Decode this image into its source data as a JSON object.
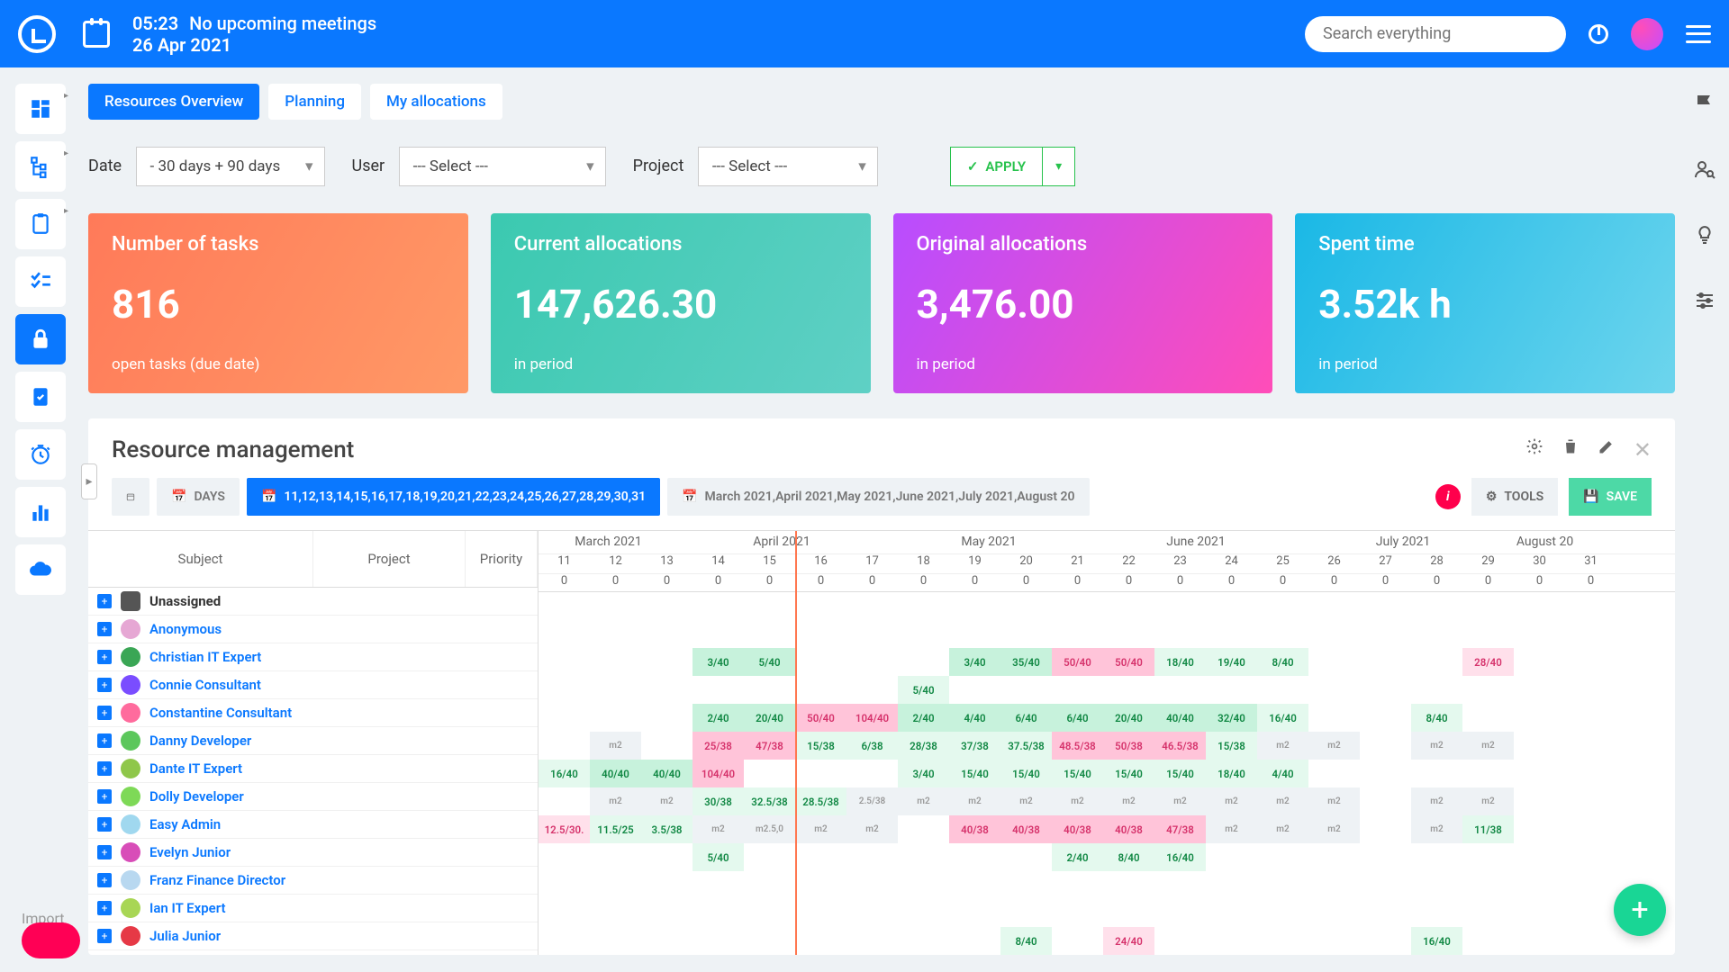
{
  "header": {
    "time": "05:23",
    "meet": "No upcoming meetings",
    "date": "26 Apr 2021",
    "search_ph": "Search everything"
  },
  "tabs": [
    "Resources Overview",
    "Planning",
    "My allocations"
  ],
  "filters": {
    "date_lbl": "Date",
    "date_val": "- 30 days + 90 days",
    "user_lbl": "User",
    "user_val": "--- Select ---",
    "proj_lbl": "Project",
    "proj_val": "--- Select ---",
    "apply": "APPLY"
  },
  "cards": [
    {
      "t": "Number of tasks",
      "v": "816",
      "s": "open tasks (due date)"
    },
    {
      "t": "Current allocations",
      "v": "147,626.30",
      "s": "in period"
    },
    {
      "t": "Original allocations",
      "v": "3,476.00",
      "s": "in period"
    },
    {
      "t": "Spent time",
      "v": "3.52k h",
      "s": "in period"
    }
  ],
  "rm": {
    "title": "Resource management",
    "days": "DAYS",
    "weeks": [
      "11",
      "12",
      "13",
      "14",
      "15",
      "16",
      "17",
      "18",
      "19",
      "20",
      "21",
      "22",
      "23",
      "24",
      "25",
      "26",
      "27",
      "28",
      "29",
      "30",
      "31"
    ],
    "months": [
      "March 2021",
      "April 2021",
      "May 2021",
      "June 2021",
      "July 2021",
      "August 20"
    ],
    "tools": "TOOLS",
    "save": "SAVE",
    "cols": {
      "subject": "Subject",
      "project": "Project",
      "priority": "Priority"
    },
    "zeros": [
      "0",
      "0",
      "0",
      "0",
      "0",
      "0",
      "0",
      "0",
      "0",
      "0",
      "0",
      "0",
      "0",
      "0",
      "0",
      "0",
      "0",
      "0",
      "0",
      "0",
      "0"
    ],
    "people": [
      {
        "name": "Unassigned",
        "clr": "#555"
      },
      {
        "name": "Anonymous",
        "clr": "#e6a7d4"
      },
      {
        "name": "Christian IT Expert",
        "clr": "#3aa655"
      },
      {
        "name": "Connie Consultant",
        "clr": "#7a4dff"
      },
      {
        "name": "Constantine Consultant",
        "clr": "#ff6b9d"
      },
      {
        "name": "Danny Developer",
        "clr": "#5cc75c"
      },
      {
        "name": "Dante IT Expert",
        "clr": "#8fc74a"
      },
      {
        "name": "Dolly Developer",
        "clr": "#7ed957"
      },
      {
        "name": "Easy Admin",
        "clr": "#a0d8ef"
      },
      {
        "name": "Evelyn Junior",
        "clr": "#d84db8"
      },
      {
        "name": "Franz Finance Director",
        "clr": "#b8d8f0"
      },
      {
        "name": "Ian IT Expert",
        "clr": "#a8d655"
      },
      {
        "name": "Julia Junior",
        "clr": "#e63946"
      }
    ],
    "rows": [
      [],
      [],
      [
        null,
        null,
        null,
        {
          "v": "3/40",
          "c": "grn"
        },
        {
          "v": "5/40",
          "c": "grn"
        },
        null,
        null,
        null,
        {
          "v": "3/40",
          "c": "grn"
        },
        {
          "v": "35/40",
          "c": "grn"
        },
        {
          "v": "50/40",
          "c": "pink"
        },
        {
          "v": "50/40",
          "c": "pink"
        },
        {
          "v": "18/40",
          "c": "lgrn"
        },
        {
          "v": "19/40",
          "c": "lgrn"
        },
        {
          "v": "8/40",
          "c": "lgrn"
        },
        null,
        null,
        null,
        {
          "v": "28/40",
          "c": "lpink"
        }
      ],
      [
        null,
        null,
        null,
        null,
        null,
        null,
        null,
        {
          "v": "5/40",
          "c": "lgrn"
        }
      ],
      [
        null,
        null,
        null,
        {
          "v": "2/40",
          "c": "grn"
        },
        {
          "v": "20/40",
          "c": "grn"
        },
        {
          "v": "50/40",
          "c": "pink"
        },
        {
          "v": "104/40",
          "c": "pink"
        },
        {
          "v": "2/40",
          "c": "grn"
        },
        {
          "v": "4/40",
          "c": "grn"
        },
        {
          "v": "6/40",
          "c": "grn"
        },
        {
          "v": "6/40",
          "c": "grn"
        },
        {
          "v": "20/40",
          "c": "grn"
        },
        {
          "v": "40/40",
          "c": "grn"
        },
        {
          "v": "32/40",
          "c": "grn"
        },
        {
          "v": "16/40",
          "c": "lgrn"
        },
        null,
        null,
        {
          "v": "8/40",
          "c": "lgrn"
        }
      ],
      [
        null,
        {
          "v": "m2",
          "c": "m2"
        },
        null,
        {
          "v": "25/38",
          "c": "pink"
        },
        {
          "v": "47/38",
          "c": "pink"
        },
        {
          "v": "15/38",
          "c": "lgrn"
        },
        {
          "v": "6/38",
          "c": "lgrn"
        },
        {
          "v": "28/38",
          "c": "lgrn"
        },
        {
          "v": "37/38",
          "c": "lgrn"
        },
        {
          "v": "37.5/38",
          "c": "lgrn"
        },
        {
          "v": "48.5/38",
          "c": "pink"
        },
        {
          "v": "50/38",
          "c": "pink"
        },
        {
          "v": "46.5/38",
          "c": "pink"
        },
        {
          "v": "15/38",
          "c": "lgrn"
        },
        {
          "v": "m2",
          "c": "m2"
        },
        {
          "v": "m2",
          "c": "m2"
        },
        null,
        {
          "v": "m2",
          "c": "m2"
        },
        {
          "v": "m2",
          "c": "m2"
        }
      ],
      [
        {
          "v": "16/40",
          "c": "lgrn"
        },
        {
          "v": "40/40",
          "c": "grn"
        },
        {
          "v": "40/40",
          "c": "grn"
        },
        {
          "v": "104/40",
          "c": "pink"
        },
        null,
        null,
        null,
        {
          "v": "3/40",
          "c": "lgrn"
        },
        {
          "v": "15/40",
          "c": "lgrn"
        },
        {
          "v": "15/40",
          "c": "lgrn"
        },
        {
          "v": "15/40",
          "c": "lgrn"
        },
        {
          "v": "15/40",
          "c": "lgrn"
        },
        {
          "v": "15/40",
          "c": "lgrn"
        },
        {
          "v": "18/40",
          "c": "lgrn"
        },
        {
          "v": "4/40",
          "c": "lgrn"
        }
      ],
      [
        null,
        {
          "v": "m2",
          "c": "m2"
        },
        {
          "v": "m2",
          "c": "m2"
        },
        {
          "v": "30/38",
          "c": "lgrn"
        },
        {
          "v": "32.5/38",
          "c": "lgrn"
        },
        {
          "v": "28.5/38",
          "c": "lgrn"
        },
        {
          "v": "2.5/38",
          "c": "m2"
        },
        {
          "v": "m2",
          "c": "m2"
        },
        {
          "v": "m2",
          "c": "m2"
        },
        {
          "v": "m2",
          "c": "m2"
        },
        {
          "v": "m2",
          "c": "m2"
        },
        {
          "v": "m2",
          "c": "m2"
        },
        {
          "v": "m2",
          "c": "m2"
        },
        {
          "v": "m2",
          "c": "m2"
        },
        {
          "v": "m2",
          "c": "m2"
        },
        {
          "v": "m2",
          "c": "m2"
        },
        null,
        {
          "v": "m2",
          "c": "m2"
        },
        {
          "v": "m2",
          "c": "m2"
        }
      ],
      [
        {
          "v": "12.5/30.",
          "c": "lpink"
        },
        {
          "v": "11.5/25",
          "c": "lgrn"
        },
        {
          "v": "3.5/38",
          "c": "lgrn"
        },
        {
          "v": "m2",
          "c": "m2"
        },
        {
          "v": "m2.5,0",
          "c": "m2"
        },
        {
          "v": "m2",
          "c": "m2"
        },
        {
          "v": "m2",
          "c": "m2"
        },
        null,
        {
          "v": "40/38",
          "c": "pink"
        },
        {
          "v": "40/38",
          "c": "pink"
        },
        {
          "v": "40/38",
          "c": "pink"
        },
        {
          "v": "40/38",
          "c": "pink"
        },
        {
          "v": "47/38",
          "c": "pink"
        },
        {
          "v": "m2",
          "c": "m2"
        },
        {
          "v": "m2",
          "c": "m2"
        },
        {
          "v": "m2",
          "c": "m2"
        },
        null,
        {
          "v": "m2",
          "c": "m2"
        },
        {
          "v": "11/38",
          "c": "lgrn"
        }
      ],
      [
        null,
        null,
        null,
        {
          "v": "5/40",
          "c": "lgrn"
        },
        null,
        null,
        null,
        null,
        null,
        null,
        {
          "v": "2/40",
          "c": "lgrn"
        },
        {
          "v": "8/40",
          "c": "lgrn"
        },
        {
          "v": "16/40",
          "c": "lgrn"
        }
      ],
      [],
      [],
      [
        null,
        null,
        null,
        null,
        null,
        null,
        null,
        null,
        null,
        {
          "v": "8/40",
          "c": "lgrn"
        },
        null,
        {
          "v": "24/40",
          "c": "lpink"
        },
        null,
        null,
        null,
        null,
        null,
        {
          "v": "16/40",
          "c": "lgrn"
        }
      ]
    ]
  },
  "import": "Import"
}
